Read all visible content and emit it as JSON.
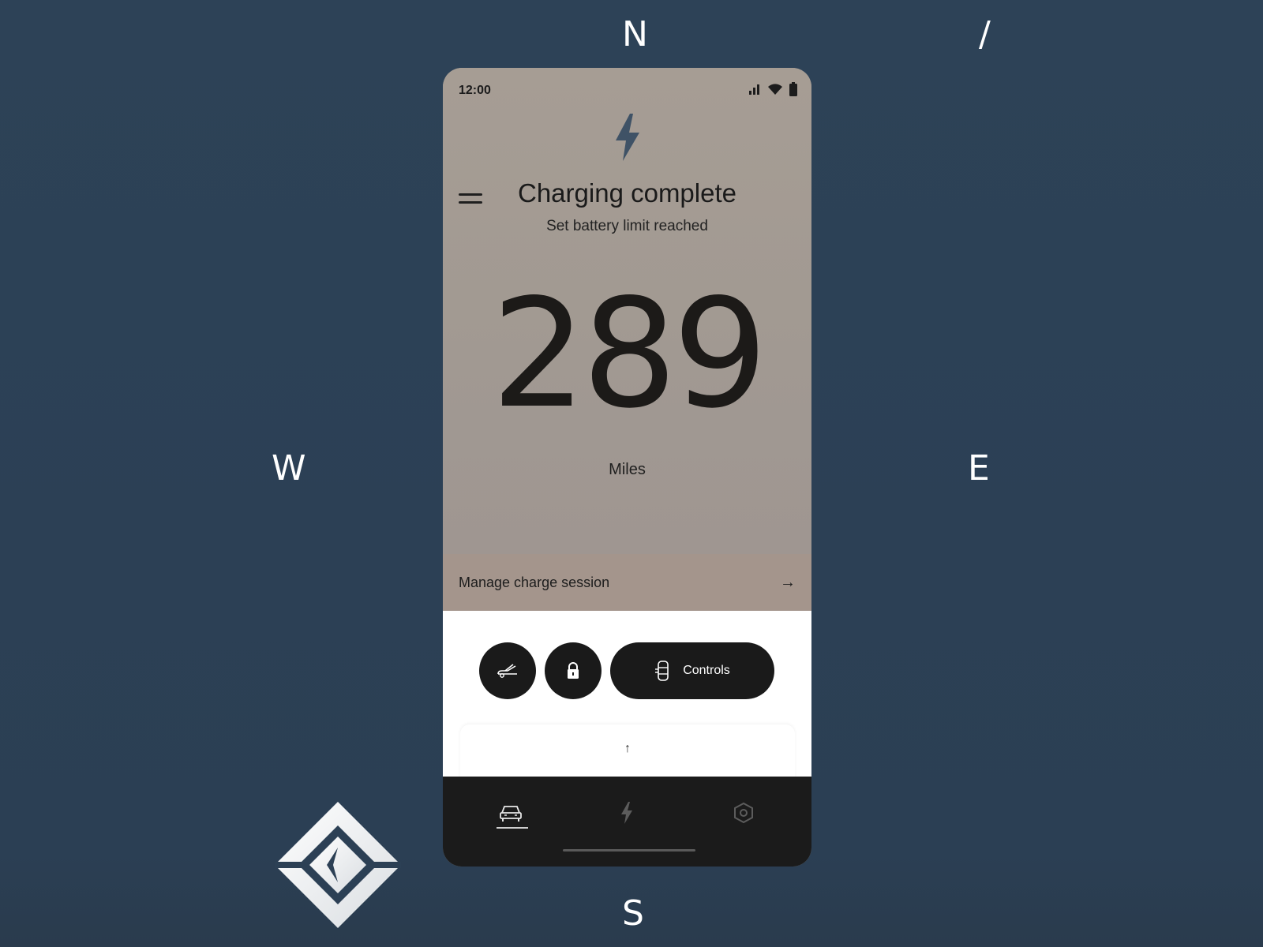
{
  "compass": {
    "north": "N",
    "slash": "/",
    "west": "W",
    "east": "E",
    "south": "S"
  },
  "phone": {
    "status": {
      "time": "12:00",
      "icons": [
        "cell-signal-icon",
        "wifi-icon",
        "battery-icon"
      ]
    },
    "header": {
      "menu_icon": "hamburger-menu-icon",
      "hero_icon": "lightning-bolt-icon"
    },
    "charging": {
      "title": "Charging complete",
      "subtitle": "Set battery limit reached",
      "range_value": "289",
      "range_unit": "Miles"
    },
    "manage": {
      "label": "Manage charge session",
      "arrow": "→"
    },
    "quick_actions": {
      "car_icon": "car-hood-icon",
      "lock_icon": "lock-icon",
      "controls_icon": "vehicle-controls-icon",
      "controls_label": "Controls"
    },
    "expand": {
      "arrow": "↑"
    },
    "bottom_nav": {
      "items": [
        {
          "name": "vehicle",
          "icon": "car-icon",
          "active": true
        },
        {
          "name": "charging",
          "icon": "lightning-bolt-icon",
          "active": false
        },
        {
          "name": "settings",
          "icon": "hexagon-settings-icon",
          "active": false
        }
      ]
    }
  },
  "colors": {
    "background": "#2c4055",
    "phone_top": "#a29a93",
    "accent_bolt": "#3f5266",
    "button_dark": "#1a1a1a"
  }
}
